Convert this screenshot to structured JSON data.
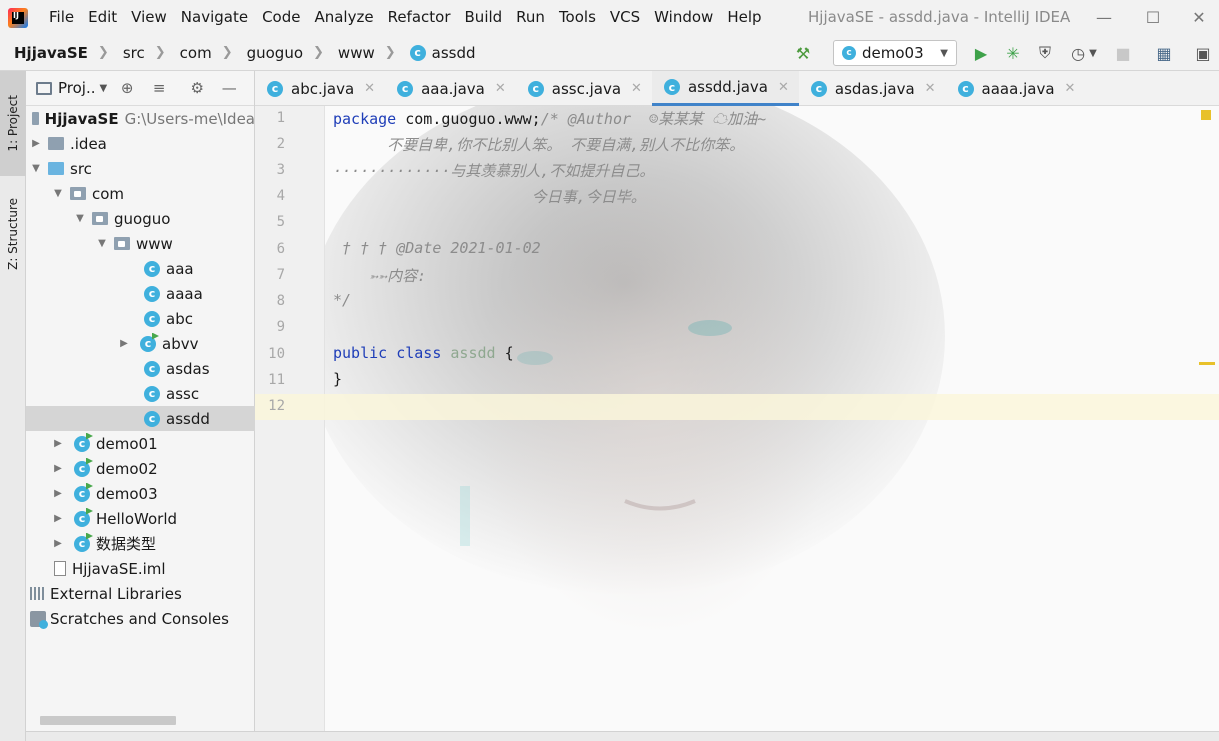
{
  "menubar": {
    "items": [
      "File",
      "Edit",
      "View",
      "Navigate",
      "Code",
      "Analyze",
      "Refactor",
      "Build",
      "Run",
      "Tools",
      "VCS",
      "Window",
      "Help"
    ],
    "window_title": "HjjavaSE - assdd.java - IntelliJ IDEA"
  },
  "breadcrumb": {
    "items": [
      "HjjavaSE",
      "src",
      "com",
      "guoguo",
      "www",
      "assdd"
    ]
  },
  "toolbar": {
    "run_config": "demo03"
  },
  "toolstrip": {
    "project_tab": "1: Project",
    "structure_tab": "Z: Structure"
  },
  "project_panel": {
    "title": "Proj..",
    "tree": [
      {
        "label": "HjjavaSE",
        "path": "G:\\Users-me\\Idea"
      },
      {
        "label": ".idea"
      },
      {
        "label": "src"
      },
      {
        "label": "com"
      },
      {
        "label": "guoguo"
      },
      {
        "label": "www"
      },
      {
        "label": "aaa"
      },
      {
        "label": "aaaa"
      },
      {
        "label": "abc"
      },
      {
        "label": "abvv"
      },
      {
        "label": "asdas"
      },
      {
        "label": "assc"
      },
      {
        "label": "assdd"
      },
      {
        "label": "demo01"
      },
      {
        "label": "demo02"
      },
      {
        "label": "demo03"
      },
      {
        "label": "HelloWorld"
      },
      {
        "label": "数据类型"
      },
      {
        "label": "HjjavaSE.iml"
      },
      {
        "label": "External Libraries"
      },
      {
        "label": "Scratches and Consoles"
      }
    ]
  },
  "editor": {
    "tabs": [
      "abc.java",
      "aaa.java",
      "assc.java",
      "assdd.java",
      "asdas.java",
      "aaaa.java"
    ],
    "active_tab": "assdd.java",
    "line_numbers": [
      "1",
      "2",
      "3",
      "4",
      "5",
      "6",
      "7",
      "8",
      "9",
      "10",
      "11",
      "12"
    ],
    "lines": {
      "l1_kw": "package",
      "l1_code": " com.guoguo.www;",
      "l1_cm": "/* @Author  ☺某某某 ☁加油~",
      "l2": "      不要自卑,你不比别人笨。 不要自满,别人不比你笨。",
      "l3": "·············与其羡慕别人,不如提升自己。",
      "l4": "                      今日事,今日毕。",
      "l6": " † † † @Date 2021-01-02",
      "l7": "    ➳➳内容:",
      "l8": "*/",
      "l10_kw1": "public",
      "l10_kw2": "class",
      "l10_cls": "assdd",
      "l10_rest": " {",
      "l11": "}"
    }
  }
}
